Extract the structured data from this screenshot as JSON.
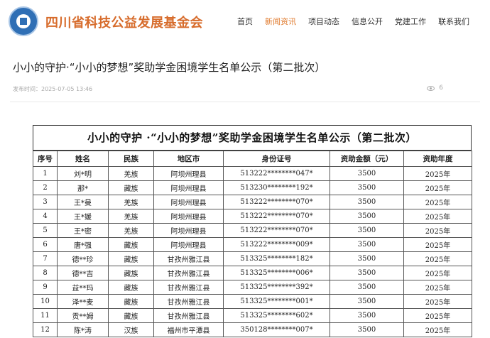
{
  "header": {
    "site_name": "四川省科技公益发展基金会",
    "nav": [
      "首页",
      "新闻资讯",
      "项目动态",
      "信息公开",
      "党建工作",
      "联系我们"
    ],
    "active_index": 1
  },
  "article": {
    "title": "小小的守护·“小小的梦想”奖助学金困境学生名单公示（第二批次）",
    "meta": "发布时间：2025-07-05 13:46",
    "views": "6"
  },
  "document": {
    "title": "小小的守护 ·“小小的梦想”奖助学金困境学生名单公示（第二批次）",
    "columns": [
      "序号",
      "姓名",
      "民族",
      "地区市",
      "身份证号",
      "资助金额（元）",
      "资助年度"
    ],
    "rows": [
      [
        "1",
        "刘*明",
        "羌族",
        "阿坝州理县",
        "513222********047*",
        "3500",
        "2025年"
      ],
      [
        "2",
        "那*",
        "藏族",
        "阿坝州理县",
        "513230********192*",
        "3500",
        "2025年"
      ],
      [
        "3",
        "王*曼",
        "羌族",
        "阿坝州理县",
        "513222********070*",
        "3500",
        "2025年"
      ],
      [
        "4",
        "王*媛",
        "羌族",
        "阿坝州理县",
        "513222********070*",
        "3500",
        "2025年"
      ],
      [
        "5",
        "王*密",
        "羌族",
        "阿坝州理县",
        "513222********070*",
        "3500",
        "2025年"
      ],
      [
        "6",
        "唐*强",
        "藏族",
        "阿坝州理县",
        "513222********009*",
        "3500",
        "2025年"
      ],
      [
        "7",
        "德**珍",
        "藏族",
        "甘孜州雅江县",
        "513325********182*",
        "3500",
        "2025年"
      ],
      [
        "8",
        "德**吉",
        "藏族",
        "甘孜州雅江县",
        "513325********006*",
        "3500",
        "2025年"
      ],
      [
        "9",
        "益**玛",
        "藏族",
        "甘孜州雅江县",
        "513325********392*",
        "3500",
        "2025年"
      ],
      [
        "10",
        "泽**麦",
        "藏族",
        "甘孜州雅江县",
        "513325********001*",
        "3500",
        "2025年"
      ],
      [
        "11",
        "贡**姆",
        "藏族",
        "甘孜州雅江县",
        "513325********602*",
        "3500",
        "2025年"
      ],
      [
        "12",
        "陈*涛",
        "汉族",
        "福州市平潭县",
        "350128********007*",
        "3500",
        "2025年"
      ]
    ]
  }
}
